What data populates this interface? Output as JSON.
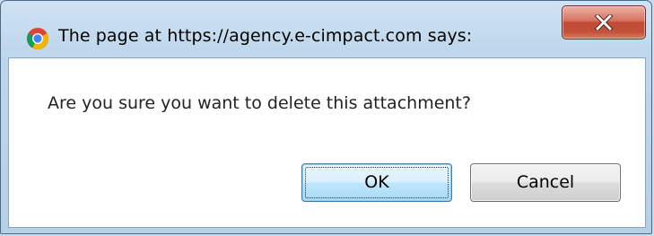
{
  "dialog": {
    "title": "The page at https://agency.e-cimpact.com says:",
    "message": "Are you sure you want to delete this attachment?",
    "ok_label": "OK",
    "cancel_label": "Cancel",
    "close_symbol": "x",
    "title_icon": "chrome-icon",
    "close_icon": "close-icon"
  },
  "colors": {
    "close_button": "#c4513c",
    "ok_button_border": "#3c7fb1",
    "window_frame": "#bfd7ec"
  }
}
